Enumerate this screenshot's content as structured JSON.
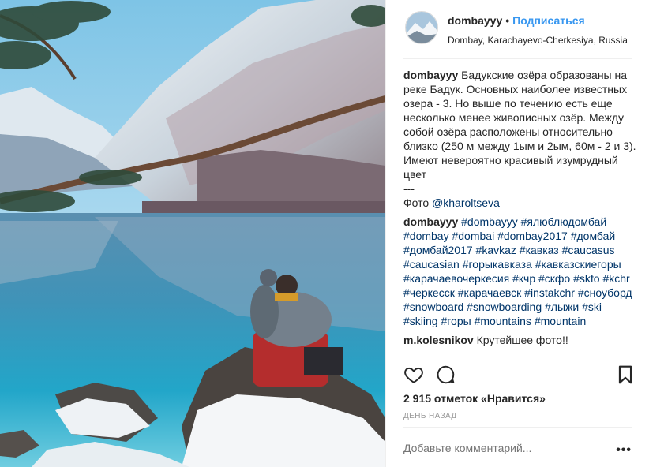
{
  "post": {
    "username": "dombayyy",
    "follow_label": "Подписаться",
    "location": "Dombay, Karachayevo-Cherkesiya, Russia"
  },
  "comments": [
    {
      "user": "dombayyy",
      "text": "Бадукские озёра образованы на реке Бадук. Основных наиболее известных озера - 3. Но выше по течению есть еще несколько менее живописных озёр. Между собой озёра расположены относительно близко (250 м между 1ым и 2ым, 60м - 2 и 3). Имеют невероятно красивый изумрудный цвет",
      "separator": "---",
      "photo_prefix": "Фото ",
      "mention": "@kharoltseva"
    },
    {
      "user": "dombayyy",
      "hashtags": "#dombayyy #ялюблюдомбай #dombay #dombai #dombay2017 #домбай #домбай2017 #kavkaz #кавказ #caucasus #caucasian #горыкавказа #кавказскиегоры #карачаевочеркесия #кчр #скфо #skfo #kchr #черкесск #карачаевск #instakchr #сноуборд #snowboard #snowboarding #лыжи #ski #skiing #горы #mountains #mountain"
    },
    {
      "user": "m.kolesnikov",
      "text": "Крутейшее фото!!"
    }
  ],
  "icons": [
    "heart-icon",
    "comment-icon",
    "bookmark-icon",
    "more-options-icon"
  ],
  "likes": "2 915 отметок «Нравится»",
  "time": "ДЕНЬ НАЗАД",
  "add_comment_placeholder": "Добавьте комментарий...",
  "more_label": "•••",
  "colors": {
    "link": "#003569",
    "follow": "#3897f0",
    "muted": "#999999"
  }
}
